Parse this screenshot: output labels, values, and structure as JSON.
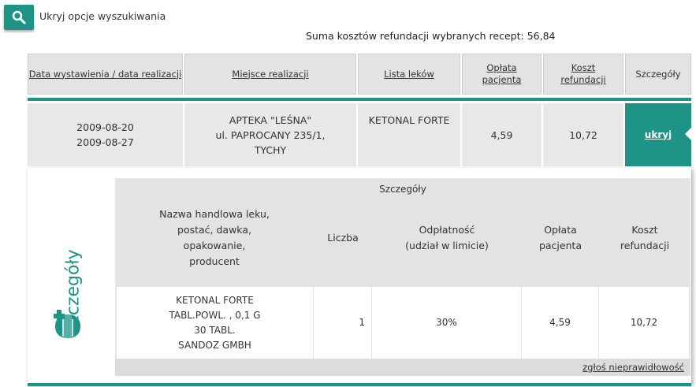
{
  "search": {
    "icon": "search-icon",
    "toggle_label": "Ukryj opcje wyszukiwania",
    "sum_text": "Suma kosztów refundacji wybranych recept: 56,84"
  },
  "colors": {
    "accent": "#1e9486",
    "header_bg": "#e3e3e3"
  },
  "results": {
    "headers": {
      "date": "Data wystawienia / data realizacji",
      "place": "Miejsce realizacji",
      "drugs": "Lista leków",
      "fee_1": "Opłata",
      "fee_2": "pacjenta",
      "cost_1": "Koszt",
      "cost_2": "refundacji",
      "details": "Szczegóły"
    },
    "row": {
      "date_issued": "2009-08-20",
      "date_realized": "2009-08-27",
      "place_1": "APTEKA \"LEŚNA\"",
      "place_2": "ul. PAPROCANY 235/1,",
      "place_3": "TYCHY",
      "drug": "KETONAL FORTE",
      "fee": "4,59",
      "cost": "10,72",
      "hide_label": "ukryj"
    }
  },
  "details": {
    "side_title": "Szczegóły",
    "side_icon": "pill-icon",
    "table_title": "Szczegóły",
    "headers": {
      "name_1": "Nazwa handlowa leku,",
      "name_2": "postać, dawka,",
      "name_3": "opakowanie,",
      "name_4": "producent",
      "count": "Liczba",
      "copay_1": "Odpłatność",
      "copay_2": "(udział w limicie)",
      "fee_1": "Opłata",
      "fee_2": "pacjenta",
      "cost_1": "Koszt",
      "cost_2": "refundacji"
    },
    "row": {
      "name_1": "KETONAL FORTE",
      "name_2": "TABL.POWL. , 0,1 G",
      "name_3": "30 TABL.",
      "name_4": "SANDOZ GMBH",
      "count": "1",
      "copay": "30%",
      "fee": "4,59",
      "cost": "10,72"
    },
    "report_link": "zgłoś nieprawidłowość"
  }
}
